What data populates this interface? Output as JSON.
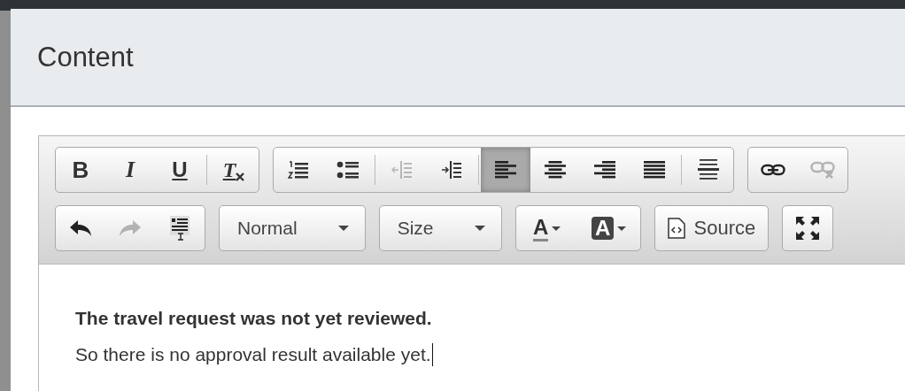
{
  "dialog": {
    "title": "Content"
  },
  "toolbar": {
    "rows": [
      {
        "groups": [
          {
            "sections": [
              [
                {
                  "kind": "bold",
                  "glyph": "B",
                  "on": false,
                  "disabled": false
                },
                {
                  "kind": "italic",
                  "glyph": "I",
                  "on": false,
                  "disabled": false
                },
                {
                  "kind": "underline",
                  "glyph": "U",
                  "on": false,
                  "disabled": false
                }
              ],
              [
                {
                  "kind": "remove-format",
                  "glyph": "T",
                  "on": false,
                  "disabled": false
                }
              ]
            ]
          },
          {
            "sections": [
              [
                {
                  "kind": "numbered-list",
                  "on": false,
                  "disabled": false
                },
                {
                  "kind": "bulleted-list",
                  "on": false,
                  "disabled": false
                }
              ],
              [
                {
                  "kind": "outdent",
                  "on": false,
                  "disabled": true
                },
                {
                  "kind": "indent",
                  "on": false,
                  "disabled": false
                }
              ],
              [
                {
                  "kind": "align-left",
                  "on": true,
                  "disabled": false
                },
                {
                  "kind": "align-center",
                  "on": false,
                  "disabled": false
                },
                {
                  "kind": "align-right",
                  "on": false,
                  "disabled": false
                },
                {
                  "kind": "justify",
                  "on": false,
                  "disabled": false
                }
              ],
              [
                {
                  "kind": "horizontal-lines",
                  "on": false,
                  "disabled": false
                }
              ]
            ]
          },
          {
            "sections": [
              [
                {
                  "kind": "link",
                  "on": false,
                  "disabled": false
                },
                {
                  "kind": "unlink",
                  "on": false,
                  "disabled": true
                }
              ]
            ]
          }
        ]
      },
      {
        "groups": [
          {
            "sections": [
              [
                {
                  "kind": "undo",
                  "on": false,
                  "disabled": false
                },
                {
                  "kind": "redo",
                  "on": false,
                  "disabled": true
                },
                {
                  "kind": "paste-text",
                  "on": false,
                  "disabled": false
                }
              ]
            ]
          },
          {
            "sections": [
              [
                {
                  "kind": "combo",
                  "label": "Normal",
                  "on": false,
                  "disabled": false
                }
              ]
            ]
          },
          {
            "sections": [
              [
                {
                  "kind": "combo",
                  "label": "Size",
                  "on": false,
                  "disabled": false
                }
              ]
            ]
          },
          {
            "sections": [
              [
                {
                  "kind": "text-color",
                  "glyph": "A",
                  "on": false,
                  "disabled": false
                },
                {
                  "kind": "background-color",
                  "glyph": "A",
                  "on": false,
                  "disabled": false
                }
              ]
            ]
          },
          {
            "sections": [
              [
                {
                  "kind": "source",
                  "label": "Source",
                  "on": false,
                  "disabled": false
                }
              ]
            ]
          },
          {
            "sections": [
              [
                {
                  "kind": "maximize",
                  "on": false,
                  "disabled": false
                }
              ]
            ]
          }
        ]
      }
    ]
  },
  "content": {
    "lines": [
      {
        "text": "The travel request was not yet reviewed.",
        "bold": true
      },
      {
        "text": "So there is no approval result available yet.",
        "bold": false
      }
    ]
  }
}
